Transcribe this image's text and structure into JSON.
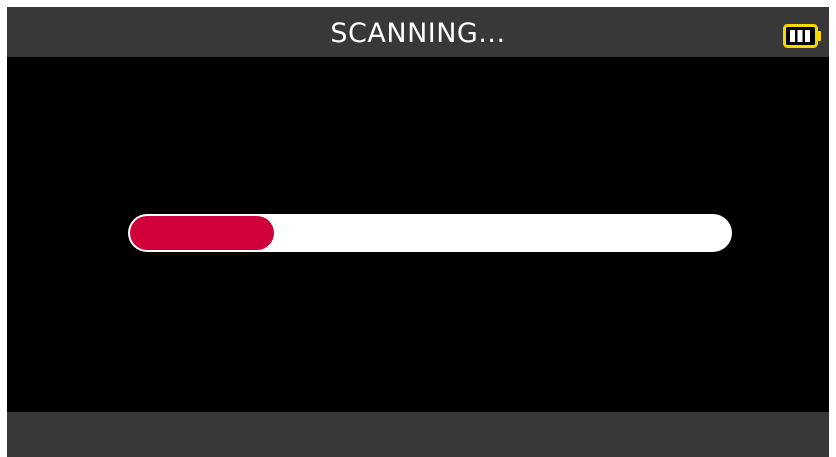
{
  "header": {
    "title": "SCANNING..."
  },
  "status": {
    "battery_icon": "battery-icon",
    "battery_level": 1.0
  },
  "progress": {
    "value": 0.24,
    "fill_color": "#d0003a",
    "track_color": "#ffffff"
  },
  "colors": {
    "bar_background": "#383838",
    "screen_background": "#000000",
    "battery_color": "#f5d800"
  }
}
